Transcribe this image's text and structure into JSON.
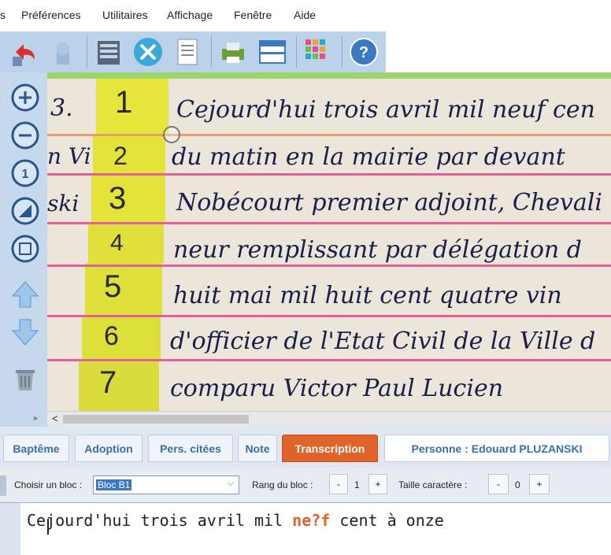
{
  "menu": [
    "s",
    "Préférences",
    "Utilitaires",
    "Affichage",
    "Fenêtre",
    "Aide"
  ],
  "viewer": {
    "line_numbers": [
      "1",
      "2",
      "3",
      "4",
      "5",
      "6",
      "7"
    ],
    "handwriting_lines": [
      "Cejourd'hui trois avril mil neuf cen",
      "du matin en la mairie par devant",
      "Nobécourt premier adjoint, Chevali",
      "neur remplissant par délégation d",
      "huit mai mil huit cent quatre vin",
      "d'officier de l'Etat Civil de la Ville d",
      "comparu Victor Paul Lucien"
    ],
    "margin_lines": [
      "3.",
      "n Vi",
      "ski",
      "",
      "",
      "",
      ""
    ]
  },
  "tabs": [
    "Baptême",
    "Adoption",
    "Pers. citées",
    "Note",
    "Transcription",
    "Personne : Edouard PLUZANSKI"
  ],
  "controls": {
    "block_label": "Choisir un bloc :",
    "block_value": "Bloc B1",
    "rank_label": "Rang du bloc :",
    "rank_value": "1",
    "size_label": "Taille caractère :",
    "size_value": "0",
    "minus": "-",
    "plus": "+"
  },
  "transcription": {
    "part1": "Cejourd'hui trois avril mil ",
    "highlight": "ne?f",
    "part2": " cent à onze"
  },
  "scroll_left": "<",
  "colors": {
    "accent_tab": "#e0632a",
    "highlight": "#e2e23a",
    "pink_line": "#e4609a"
  }
}
